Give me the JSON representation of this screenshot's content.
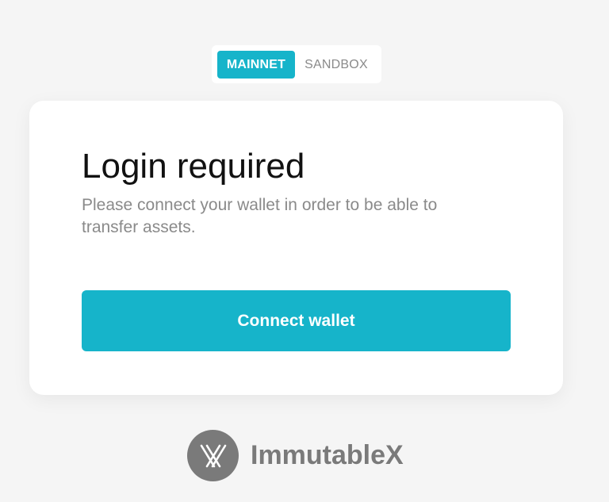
{
  "network_toggle": {
    "options": [
      {
        "label": "MAINNET",
        "selected": true
      },
      {
        "label": "SANDBOX",
        "selected": false
      }
    ]
  },
  "login_card": {
    "title": "Login required",
    "subtitle": "Please connect your wallet in order to be able to transfer assets.",
    "connect_button_label": "Connect wallet"
  },
  "brand": {
    "name": "ImmutableX",
    "logo_icon": "immutablex-x-icon"
  },
  "colors": {
    "accent": "#16b4ca",
    "background": "#f5f5f5",
    "card": "#ffffff",
    "muted_text": "#8a8a8a",
    "brand_gray": "#7a7a7a"
  }
}
